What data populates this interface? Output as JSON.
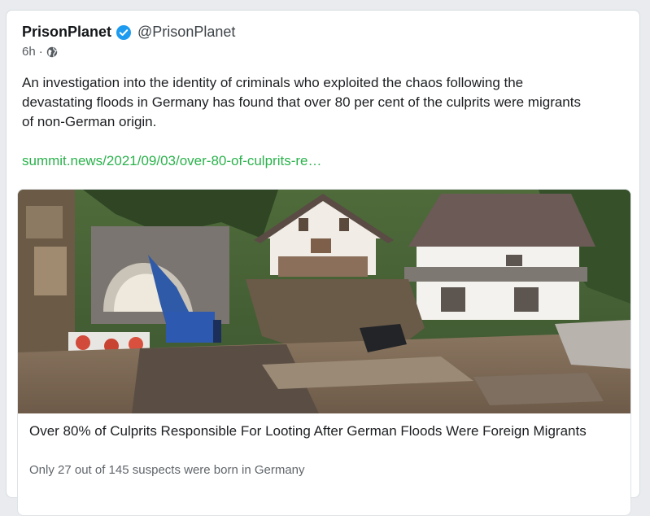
{
  "tweet": {
    "author_name": "PrisonPlanet",
    "author_handle": "@PrisonPlanet",
    "time": "6h",
    "separator": "·",
    "text": "An investigation into the identity of criminals who exploited the chaos following the devastating floods in Germany has found that over 80 per cent of the culprits were migrants of non-German origin.",
    "link_text": "summit.news/2021/09/03/over-80-of-culprits-re…",
    "icons": {
      "verified": "verified-badge-icon",
      "visibility": "globe-icon"
    }
  },
  "link_card": {
    "title": "Over 80% of Culprits Responsible For Looting After German Floods Were Foreign Migrants",
    "description": "Only 27 out of 145 suspects were born in Germany",
    "image_subject": "flood-damaged-houses-excavator-tunnel"
  },
  "colors": {
    "link": "#2bb24c",
    "verified": "#1d9bf0",
    "text": "#1c1e21",
    "muted": "#555b60"
  }
}
